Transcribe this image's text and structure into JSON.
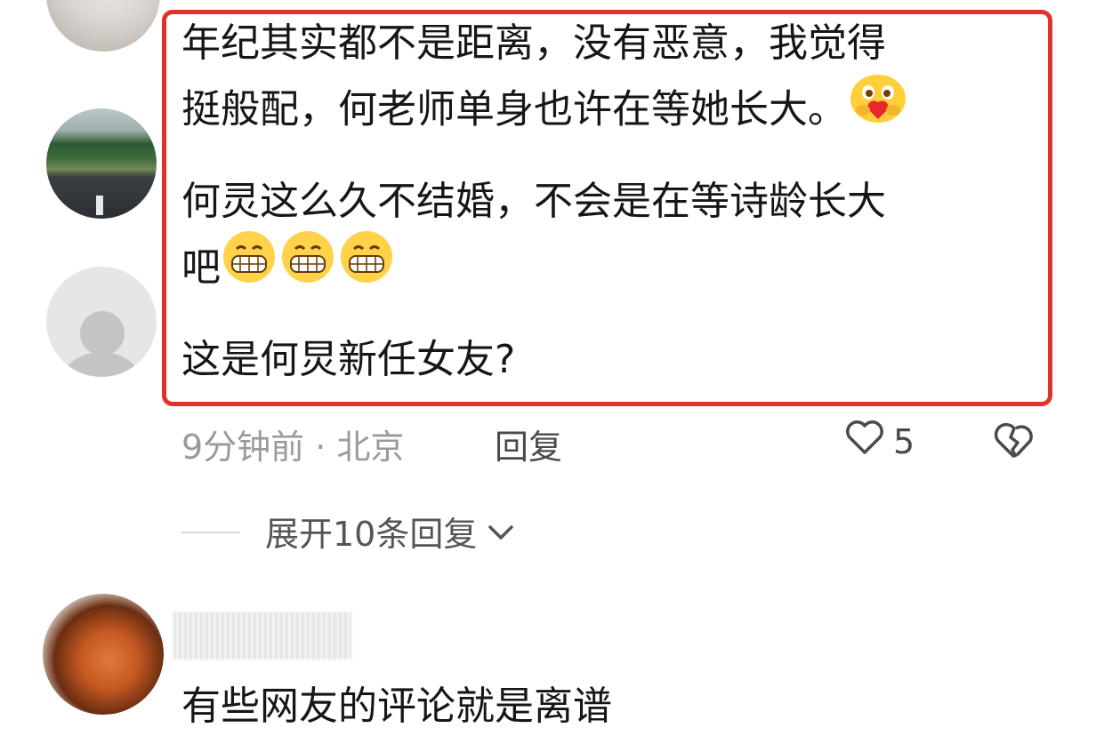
{
  "comments": {
    "first": "年纪其实都不是距离，没有恶意，我觉得",
    "first_line2": "挺般配，何老师单身也许在等她长大。",
    "second": "何灵这么久不结婚，不会是在等诗龄长大",
    "second_line2": "吧",
    "third": "这是何炅新任女友?",
    "fourth": "有些网友的评论就是离谱"
  },
  "meta": {
    "time_location": "9分钟前 · 北京",
    "reply": "回复",
    "likes": "5"
  },
  "expand": {
    "label": "展开10条回复"
  },
  "emoji": {
    "first": "heart-hug-emoji",
    "second": "grin-emoji"
  },
  "colors": {
    "highlight": "#e0322a",
    "muted_text": "#9a9a9a"
  }
}
